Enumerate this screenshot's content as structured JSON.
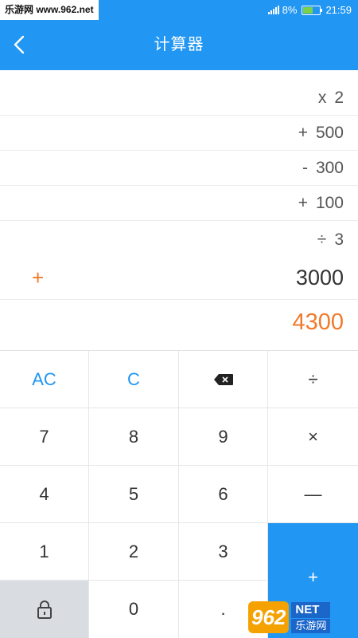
{
  "status_bar": {
    "watermark": "乐游网 www.962.net",
    "battery": "8%",
    "time": "21:59"
  },
  "app_bar": {
    "title": "计算器"
  },
  "history": [
    {
      "op": "x",
      "value": "2"
    },
    {
      "op": "+",
      "value": "500"
    },
    {
      "op": "-",
      "value": "300"
    },
    {
      "op": "+",
      "value": "100"
    },
    {
      "op": "÷",
      "value": "3"
    }
  ],
  "current": {
    "op": "+",
    "value": "3000"
  },
  "result": "4300",
  "keys": {
    "ac": "AC",
    "c": "C",
    "divide": "÷",
    "multiply": "×",
    "minus": "—",
    "plus": "+",
    "seven": "7",
    "eight": "8",
    "nine": "9",
    "four": "4",
    "five": "5",
    "six": "6",
    "one": "1",
    "two": "2",
    "three": "3",
    "zero": "0",
    "dot": "."
  },
  "watermark_bottom": {
    "logo": "962",
    "net": "NET",
    "site": "乐游网"
  },
  "colors": {
    "primary": "#2196f3",
    "accent": "#f07a2a",
    "lock_key": "#d9dde1"
  }
}
